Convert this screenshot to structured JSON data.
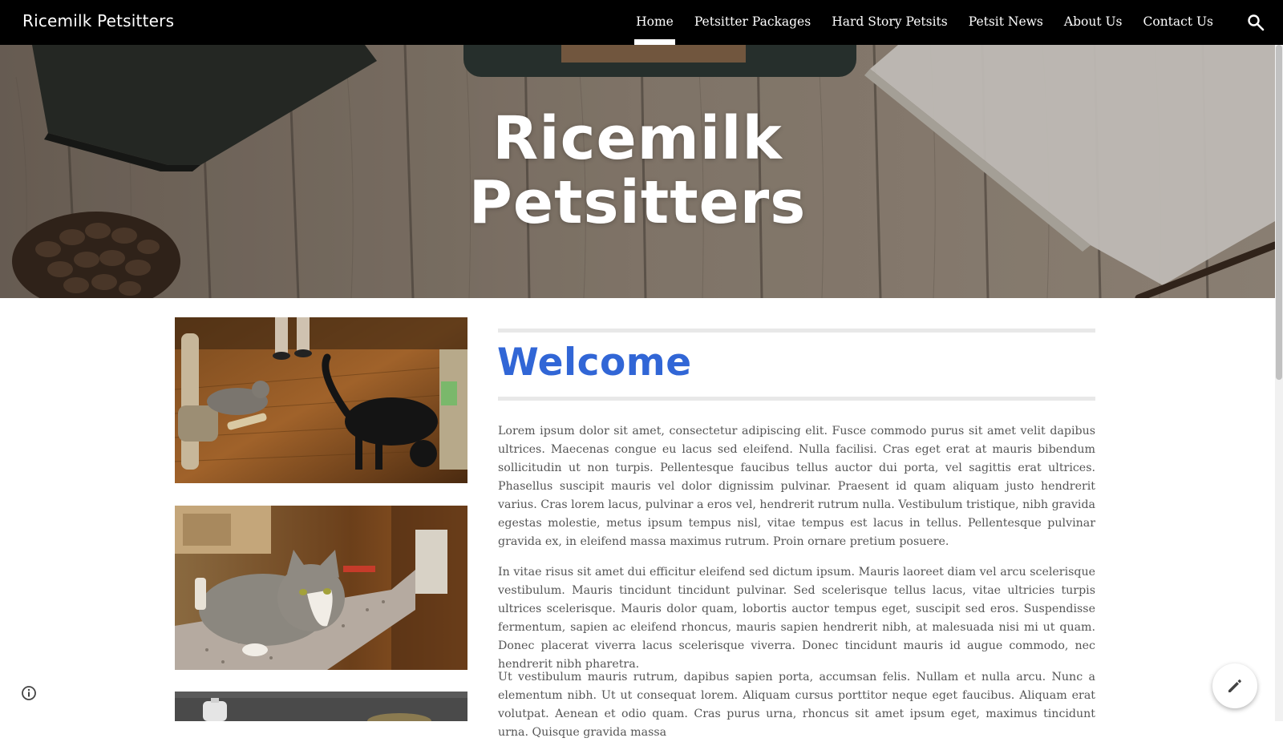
{
  "header": {
    "site_name": "Ricemilk Petsitters",
    "nav": [
      {
        "label": "Home",
        "active": true
      },
      {
        "label": "Petsitter Packages",
        "active": false
      },
      {
        "label": "Hard Story Petsits",
        "active": false
      },
      {
        "label": "Petsit News",
        "active": false
      },
      {
        "label": "About Us",
        "active": false
      },
      {
        "label": "Contact Us",
        "active": false
      }
    ],
    "search_icon": "search-icon"
  },
  "hero": {
    "title_line1": "Ricemilk",
    "title_line2": "Petsitters"
  },
  "main": {
    "heading": "Welcome",
    "heading_color": "#3166d6",
    "paragraphs": [
      "Lorem ipsum dolor sit amet, consectetur adipiscing elit. Fusce commodo purus sit amet velit dapibus ultrices. Maecenas congue eu lacus sed eleifend. Nulla facilisi. Cras eget erat at mauris bibendum sollicitudin ut non turpis. Pellentesque faucibus tellus auctor dui porta, vel sagittis erat ultrices. Phasellus suscipit mauris vel dolor dignissim pulvinar. Praesent id quam aliquam justo hendrerit varius. Cras lorem lacus, pulvinar a eros vel, hendrerit rutrum nulla. Vestibulum tristique, nibh gravida egestas molestie, metus ipsum tempus nisl, vitae tempus est lacus in tellus. Pellentesque pulvinar gravida ex, in eleifend massa maximus rutrum. Proin ornare pretium posuere.",
      "In vitae risus sit amet dui efficitur eleifend sed dictum ipsum. Mauris laoreet diam vel arcu scelerisque vestibulum. Mauris tincidunt tincidunt pulvinar. Sed scelerisque tellus lacus, vitae ultricies turpis ultrices scelerisque. Mauris dolor quam, lobortis auctor tempus eget, suscipit sed eros. Suspendisse fermentum, sapien ac eleifend rhoncus, mauris sapien hendrerit nibh, at malesuada nisi mi ut quam. Donec placerat viverra lacus scelerisque viverra. Donec tincidunt mauris id augue commodo, nec hendrerit nibh pharetra.",
      "Ut vestibulum mauris rutrum, dapibus sapien porta, accumsan felis. Nullam et nulla arcu. Nunc a elementum nibh. Ut ut consequat lorem. Aliquam cursus porttitor neque eget faucibus. Aliquam erat volutpat. Aenean et odio quam. Cras purus urna, rhoncus sit amet ipsum eget, maximus tincidunt urna. Quisque gravida massa"
    ],
    "photos": [
      "cats-on-wood-floor-photo",
      "gray-cat-on-counter-photo",
      "kitchen-photo"
    ]
  },
  "footer_controls": {
    "info_icon": "info-icon",
    "edit_icon": "pencil-icon"
  }
}
